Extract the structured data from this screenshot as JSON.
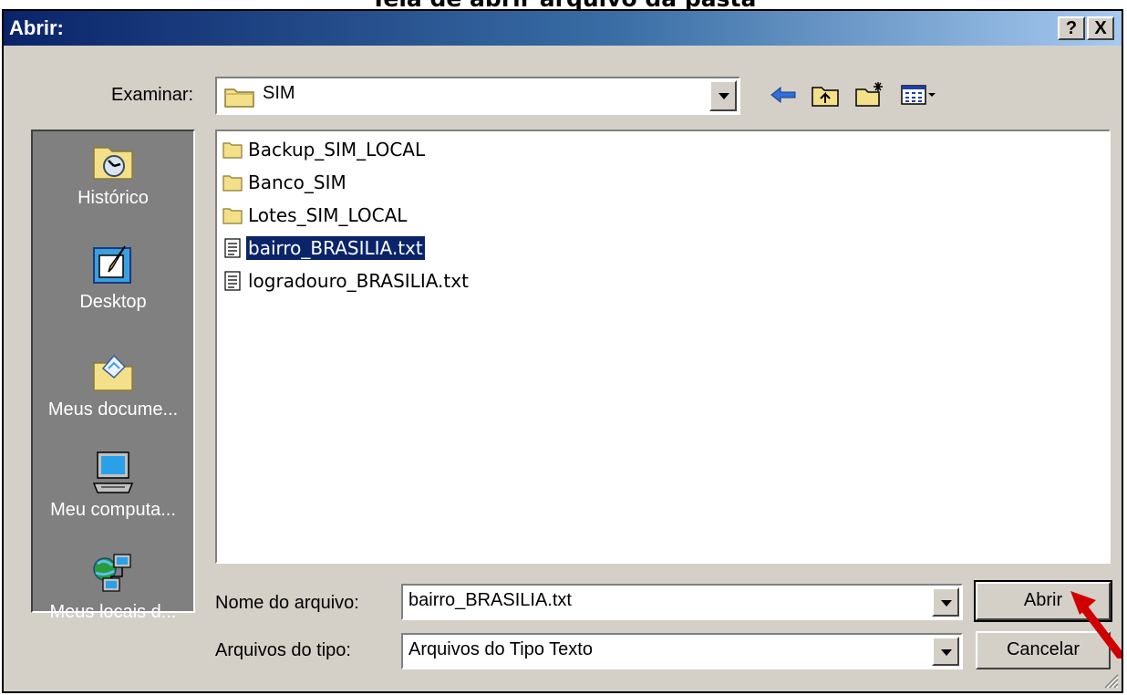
{
  "caption": "Tela de abrir arquivo da pasta",
  "window": {
    "title": "Abrir:",
    "help_label": "?",
    "close_label": "X"
  },
  "lookin": {
    "label": "Examinar:",
    "value": "SIM"
  },
  "toolbar": {
    "back_icon": "back-arrow-icon",
    "up_icon": "up-folder-icon",
    "new_folder_icon": "new-folder-icon",
    "view_icon": "view-menu-icon"
  },
  "places": [
    {
      "label": "Histórico",
      "icon": "history-icon"
    },
    {
      "label": "Desktop",
      "icon": "desktop-icon"
    },
    {
      "label": "Meus docume...",
      "icon": "my-documents-icon"
    },
    {
      "label": "Meu computa...",
      "icon": "my-computer-icon"
    },
    {
      "label": "Meus locais d...",
      "icon": "network-places-icon"
    }
  ],
  "files": [
    {
      "name": "Backup_SIM_LOCAL",
      "type": "folder"
    },
    {
      "name": "Banco_SIM",
      "type": "folder"
    },
    {
      "name": "Lotes_SIM_LOCAL",
      "type": "folder"
    },
    {
      "name": "bairro_BRASILIA.txt",
      "type": "text",
      "selected": true
    },
    {
      "name": "logradouro_BRASILIA.txt",
      "type": "text"
    }
  ],
  "filename": {
    "label": "Nome do arquivo:",
    "value": "bairro_BRASILIA.txt"
  },
  "filetype": {
    "label": "Arquivos do tipo:",
    "value": "Arquivos do Tipo Texto"
  },
  "buttons": {
    "open": "Abrir",
    "cancel": "Cancelar"
  },
  "colors": {
    "title_start": "#0a246a",
    "title_end": "#a6caf0",
    "face": "#d4d0c8",
    "selection": "#0a246a",
    "arrow": "#d00000"
  }
}
